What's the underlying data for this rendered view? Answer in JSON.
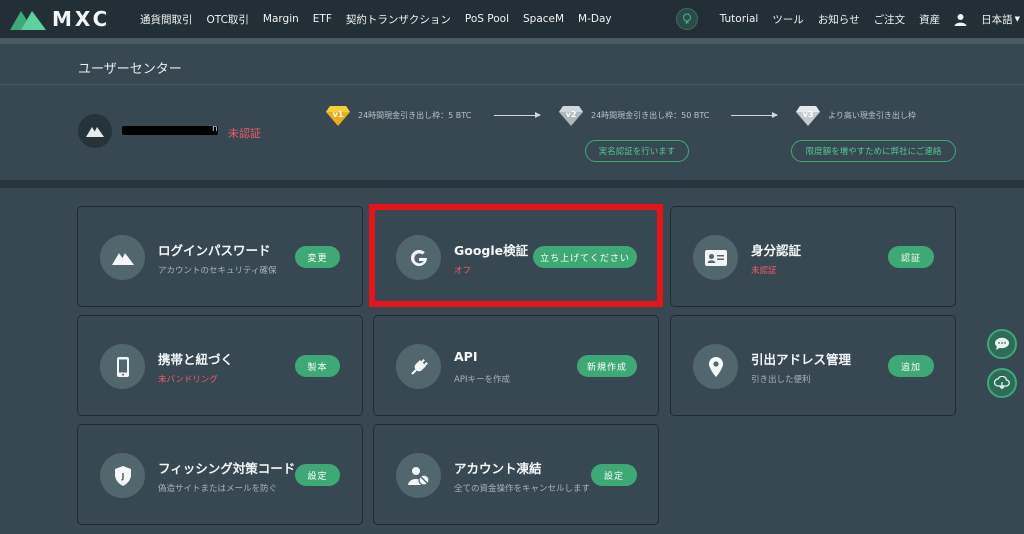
{
  "brand": {
    "name": "MXC"
  },
  "nav": [
    "通貨間取引",
    "OTC取引",
    "Margin",
    "ETF",
    "契約トランザクション",
    "PoS Pool",
    "SpaceM",
    "M-Day"
  ],
  "right_nav": {
    "tutorial": "Tutorial",
    "tools": "ツール",
    "news": "お知らせ",
    "orders": "ご注文",
    "assets": "資産",
    "language": "日本語"
  },
  "page_title": "ユーザーセンター",
  "user": {
    "name_tail": "n",
    "status": "未認証"
  },
  "levels": [
    {
      "badge": "v1",
      "text": "24時間現金引き出し枠：5 BTC"
    },
    {
      "badge": "v2",
      "text": "24時間現金引き出し枠：50 BTC"
    },
    {
      "badge": "v3",
      "text": "より高い現金引き出し枠"
    }
  ],
  "level_actions": {
    "verify": "実名認証を行います",
    "contact": "限度額を増やすために弊社にご連絡"
  },
  "cards": {
    "login": {
      "title": "ログインパスワード",
      "sub": "アカウントのセキュリティ確保",
      "btn": "変更"
    },
    "google": {
      "title": "Google検証",
      "sub": "オフ",
      "btn": "立ち上げてください"
    },
    "identity": {
      "title": "身分認証",
      "sub": "未認証",
      "btn": "認証"
    },
    "phone": {
      "title": "携帯と紐づく",
      "sub": "未バンドリング",
      "btn": "製本"
    },
    "api": {
      "title": "API",
      "sub": "APIキーを作成",
      "btn": "新規作成"
    },
    "withdraw": {
      "title": "引出アドレス管理",
      "sub": "引き出した便利",
      "btn": "追加"
    },
    "phishing": {
      "title": "フィッシング対策コード",
      "sub": "偽造サイトまたはメールを防ぐ",
      "btn": "設定"
    },
    "freeze": {
      "title": "アカウント凍結",
      "sub": "全ての資金操作をキャンセルします",
      "btn": "設定"
    }
  },
  "colors": {
    "accent": "#3ea977",
    "danger": "#f35a6a",
    "highlight": "#e3151b",
    "background": "#384852"
  }
}
